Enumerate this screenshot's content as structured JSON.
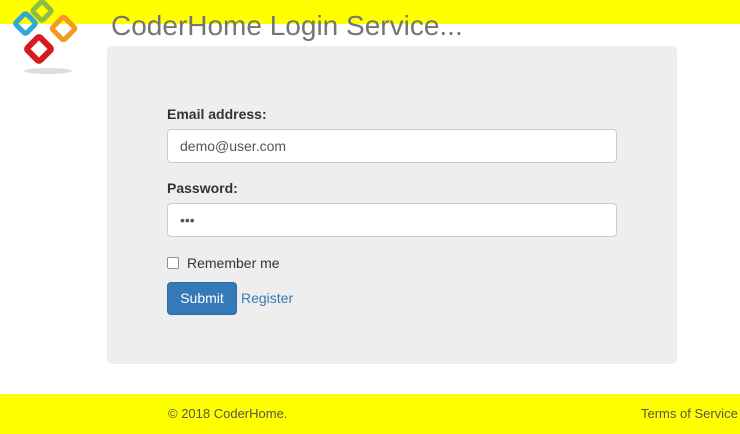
{
  "header": {
    "title": "CoderHome Login Service..."
  },
  "login_form": {
    "email_label": "Email address:",
    "email_value": "demo@user.com",
    "password_label": "Password:",
    "password_value": "•••",
    "remember_label": "Remember me",
    "remember_checked": false,
    "submit_label": "Submit",
    "register_label": "Register"
  },
  "footer": {
    "copyright": "© 2018 CoderHome.",
    "terms": "Terms of Service"
  },
  "colors": {
    "banner": "#ffff00",
    "panel": "#eeeeee",
    "primary_button": "#337ab7",
    "link": "#337ab7"
  }
}
